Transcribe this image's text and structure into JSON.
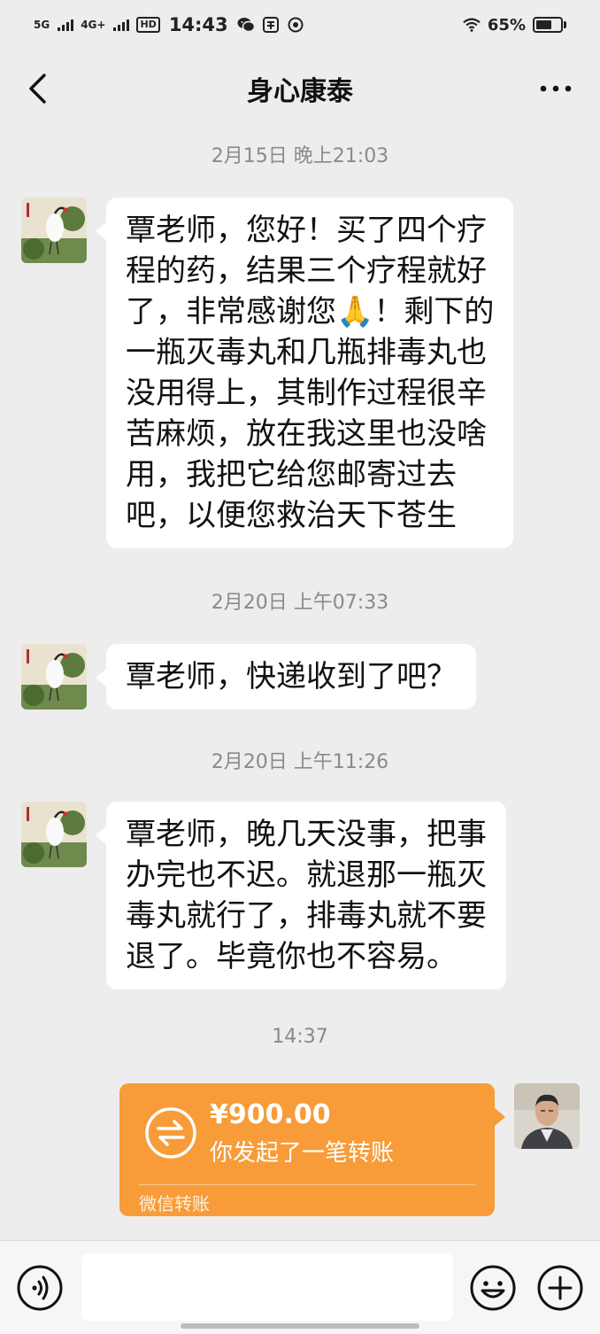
{
  "status_bar": {
    "signal_1": "5G",
    "signal_2": "4G+",
    "hd": "HD",
    "time": "14:43",
    "battery_percent": "65%",
    "battery_level": 0.65
  },
  "nav": {
    "title": "身心康泰"
  },
  "messages": [
    {
      "time": "2月15日 晚上21:03",
      "lines": [
        "覃老师，您好！买了四个疗",
        "程的药，结果三个疗程就好",
        "了，非常感谢您🙏！剩下的",
        "一瓶灭毒丸和几瓶排毒丸也",
        "没用得上，其制作过程很辛",
        "苦麻烦，放在我这里也没啥",
        "用，我把它给您邮寄过去",
        "吧，以便您救治天下苍生"
      ]
    },
    {
      "time": "2月20日 上午07:33",
      "lines": [
        "覃老师，快递收到了吧？"
      ]
    },
    {
      "time": "2月20日 上午11:26",
      "lines": [
        "覃老师，晚几天没事，把事",
        "办完也不迟。就退那一瓶灭",
        "毒丸就行了，排毒丸就不要",
        "退了。毕竟你也不容易。"
      ]
    }
  ],
  "transfer": {
    "time": "14:37",
    "amount": "¥900.00",
    "description": "你发起了一笔转账",
    "footer": "微信转账",
    "color": "#f79c39"
  },
  "input": {
    "placeholder": ""
  }
}
